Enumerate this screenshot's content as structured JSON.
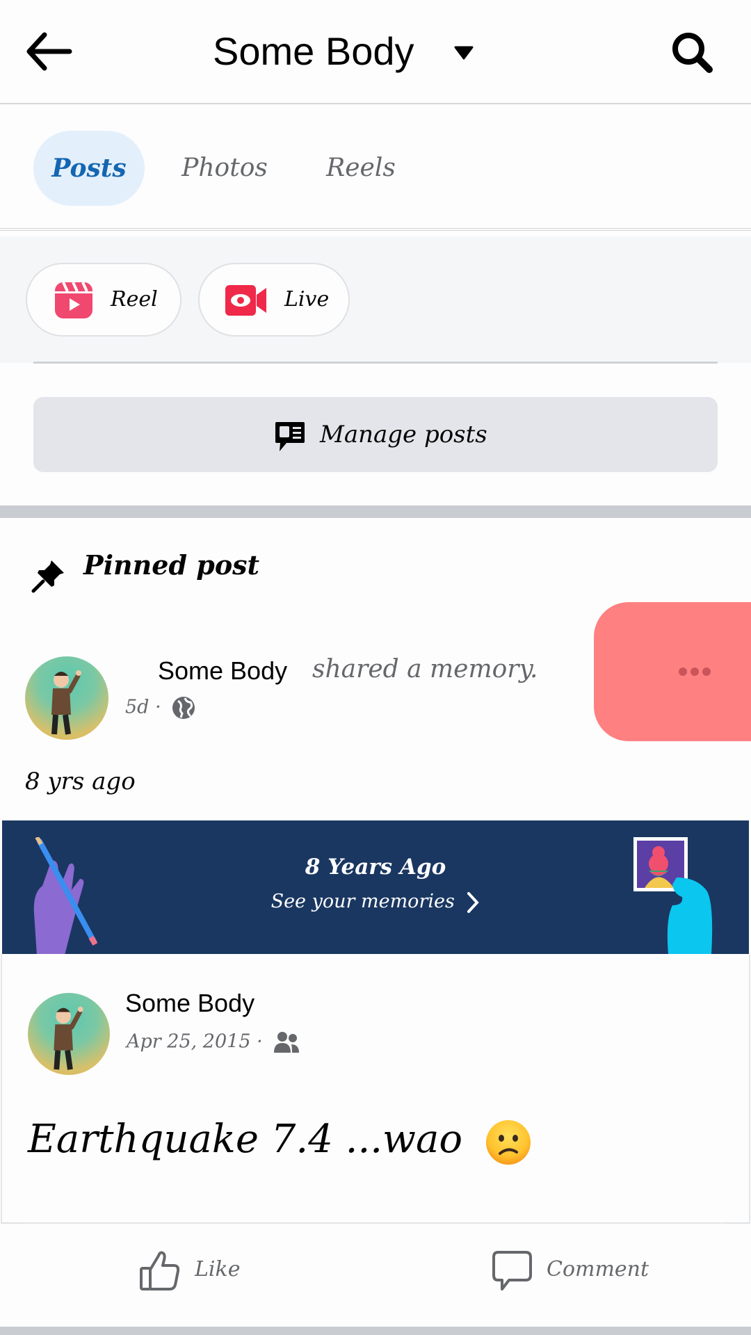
{
  "header": {
    "back_icon": "arrow-left-icon",
    "title": "Some Body",
    "title_dropdown_icon": "caret-down-icon",
    "search_icon": "search-icon"
  },
  "tabs": [
    {
      "label": "Posts",
      "active": true
    },
    {
      "label": "Photos",
      "active": false
    },
    {
      "label": "Reels",
      "active": false
    }
  ],
  "create": {
    "reel": {
      "label": "Reel",
      "icon": "reels-icon",
      "color": "#f0486e"
    },
    "live": {
      "label": "Live",
      "icon": "live-video-icon",
      "color": "#f02849"
    }
  },
  "manage_posts": {
    "label": "Manage posts",
    "icon": "manage-posts-icon"
  },
  "pinned": {
    "label": "Pinned post",
    "icon": "pin-icon",
    "author": "Some Body",
    "action_text": "shared a memory.",
    "time": "5d",
    "separator": "·",
    "audience_icon": "globe-icon",
    "more_icon": "more-horizontal-icon",
    "more_highlight_color": "#fe8080",
    "memory_caption": "8 yrs ago"
  },
  "memory_banner": {
    "title": "8 Years Ago",
    "link": "See your memories",
    "link_icon": "chevron-right-icon",
    "background": "#1a3761"
  },
  "shared_post": {
    "author": "Some Body",
    "date": "Apr 25, 2015",
    "separator": "·",
    "audience_icon": "friends-icon",
    "text": "Earthquake 7.4  ...wao",
    "emoji": "confused-face-emoji"
  },
  "actions": {
    "like": {
      "label": "Like",
      "icon": "thumbs-up-icon"
    },
    "comment": {
      "label": "Comment",
      "icon": "comment-icon"
    }
  }
}
